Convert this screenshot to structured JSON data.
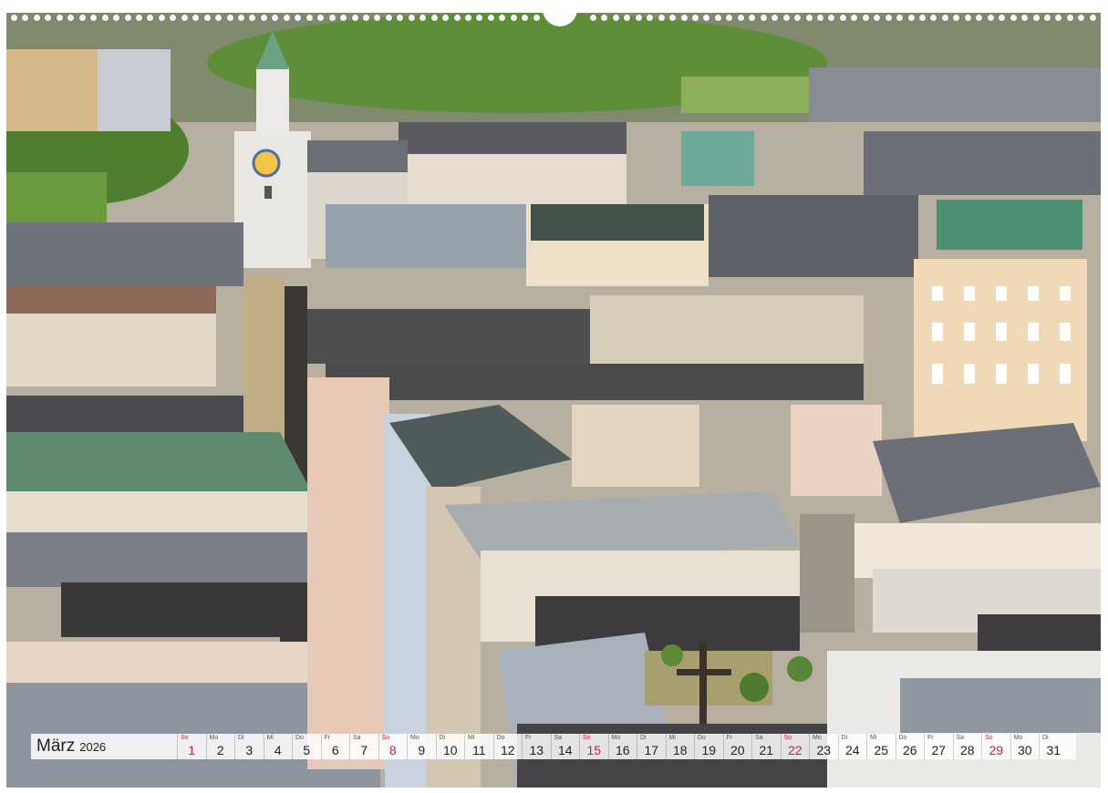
{
  "calendar": {
    "month": "März",
    "year": "2026",
    "accent_color": "#d21f3c",
    "days": [
      {
        "wd": "So",
        "n": "1",
        "sun": true
      },
      {
        "wd": "Mo",
        "n": "2"
      },
      {
        "wd": "Di",
        "n": "3"
      },
      {
        "wd": "Mi",
        "n": "4"
      },
      {
        "wd": "Do",
        "n": "5"
      },
      {
        "wd": "Fr",
        "n": "6"
      },
      {
        "wd": "Sa",
        "n": "7"
      },
      {
        "wd": "So",
        "n": "8",
        "sun": true
      },
      {
        "wd": "Mo",
        "n": "9"
      },
      {
        "wd": "Di",
        "n": "10"
      },
      {
        "wd": "Mi",
        "n": "11"
      },
      {
        "wd": "Do",
        "n": "12"
      },
      {
        "wd": "Fr",
        "n": "13"
      },
      {
        "wd": "Sa",
        "n": "14"
      },
      {
        "wd": "So",
        "n": "15",
        "sun": true
      },
      {
        "wd": "Mo",
        "n": "16"
      },
      {
        "wd": "Di",
        "n": "17"
      },
      {
        "wd": "Mi",
        "n": "18"
      },
      {
        "wd": "Do",
        "n": "19"
      },
      {
        "wd": "Fr",
        "n": "20"
      },
      {
        "wd": "Sa",
        "n": "21"
      },
      {
        "wd": "So",
        "n": "22",
        "sun": true
      },
      {
        "wd": "Mo",
        "n": "23"
      },
      {
        "wd": "Di",
        "n": "24"
      },
      {
        "wd": "Mi",
        "n": "25"
      },
      {
        "wd": "Do",
        "n": "26"
      },
      {
        "wd": "Fr",
        "n": "27"
      },
      {
        "wd": "Sa",
        "n": "28"
      },
      {
        "wd": "So",
        "n": "29",
        "sun": true
      },
      {
        "wd": "Mo",
        "n": "30"
      },
      {
        "wd": "Di",
        "n": "31"
      }
    ]
  }
}
